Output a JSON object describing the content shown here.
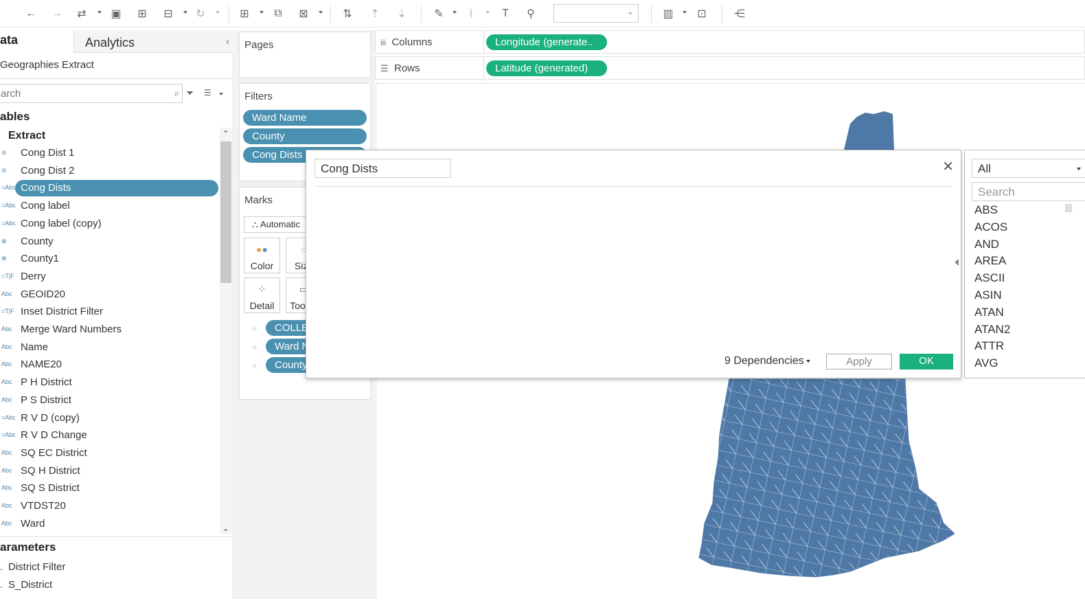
{
  "toolbar": {
    "fit_dropdown_value": ""
  },
  "left_panel": {
    "tab_data": "ata",
    "tab_analytics": "Analytics",
    "collapse_icon": "chevron-left-icon",
    "datasource": "Geographies Extract",
    "search_placeholder": "arch",
    "tables_heading": "ables",
    "extract_heading": "Extract",
    "fields": [
      {
        "icon": "⊝",
        "name": "Cong Dist 1",
        "selected": false
      },
      {
        "icon": "⊝",
        "name": "Cong Dist 2",
        "selected": false
      },
      {
        "icon": "=Abc",
        "name": "Cong Dists",
        "selected": true
      },
      {
        "icon": "=Abc",
        "name": "Cong label",
        "selected": false
      },
      {
        "icon": "=Abc",
        "name": "Cong label (copy)",
        "selected": false
      },
      {
        "icon": "⊕",
        "name": "County",
        "selected": false
      },
      {
        "icon": "⊕",
        "name": "County1",
        "selected": false
      },
      {
        "icon": "=T|F",
        "name": "Derry",
        "selected": false
      },
      {
        "icon": "Abc",
        "name": "GEOID20",
        "selected": false
      },
      {
        "icon": "=T|F",
        "name": "Inset District Filter",
        "selected": false
      },
      {
        "icon": "Abc",
        "name": "Merge Ward Numbers",
        "selected": false
      },
      {
        "icon": "Abc",
        "name": "Name",
        "selected": false
      },
      {
        "icon": "Abc",
        "name": "NAME20",
        "selected": false
      },
      {
        "icon": "Abc",
        "name": "P H District",
        "selected": false
      },
      {
        "icon": "Abc",
        "name": "P S District",
        "selected": false
      },
      {
        "icon": "=Abc",
        "name": "R V D (copy)",
        "selected": false
      },
      {
        "icon": "=Abc",
        "name": "R V D Change",
        "selected": false
      },
      {
        "icon": "Abc",
        "name": "SQ EC District",
        "selected": false
      },
      {
        "icon": "Abc",
        "name": "SQ H District",
        "selected": false
      },
      {
        "icon": "Abc",
        "name": "SQ S District",
        "selected": false
      },
      {
        "icon": "Abc",
        "name": "VTDST20",
        "selected": false
      },
      {
        "icon": "Abc",
        "name": "Ward",
        "selected": false
      }
    ],
    "parameters_heading": "arameters",
    "parameters": [
      "District Filter",
      "S_District"
    ]
  },
  "pages": {
    "title": "Pages"
  },
  "filters": {
    "title": "Filters",
    "pills": [
      "Ward Name",
      "County",
      "Cong Dists"
    ]
  },
  "marks": {
    "title": "Marks",
    "type": "Automatic",
    "buttons": [
      "Color",
      "Size",
      "Detail",
      "Tooltip"
    ],
    "pills": [
      "COLLEGE",
      "Ward Name",
      "County"
    ]
  },
  "columns": {
    "label": "Columns",
    "pill": "Longitude (generate.."
  },
  "rows": {
    "label": "Rows",
    "pill": "Latitude (generated)"
  },
  "dialog": {
    "calc_name": "Cong Dists",
    "formula": "",
    "dependencies": "9 Dependencies",
    "apply": "Apply",
    "ok": "OK"
  },
  "functions": {
    "category": "All",
    "search_placeholder": "Search",
    "items": [
      "ABS",
      "ACOS",
      "AND",
      "AREA",
      "ASCII",
      "ASIN",
      "ATAN",
      "ATAN2",
      "ATTR",
      "AVG"
    ]
  },
  "colors": {
    "pill_blue": "#4a90b0",
    "pill_green": "#1ab07f",
    "map_fill": "#4e79a7",
    "ok_button": "#1ab07f"
  }
}
